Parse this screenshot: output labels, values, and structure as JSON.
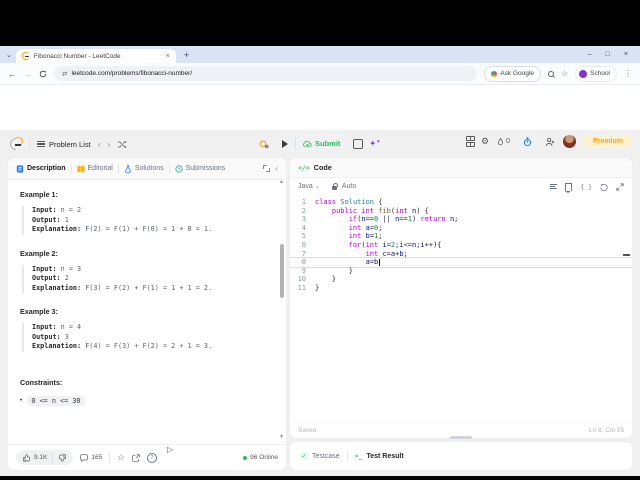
{
  "chrome": {
    "tab_title": "Fibonacci Number - LeetCode",
    "new_tab": "+",
    "url": "leetcode.com/problems/fibonacci-number/",
    "ask_google": "Ask Google",
    "profile_label": "School",
    "window": {
      "minimize": "–",
      "maximize": "□",
      "close": "×"
    }
  },
  "nav": {
    "problem_list_label": "Problem List",
    "submit_label": "Submit",
    "streak_count": "0",
    "premium_label": "Premium"
  },
  "left": {
    "tabs": [
      "Description",
      "Editorial",
      "Solutions",
      "Submissions"
    ],
    "labels": {
      "input": "Input:",
      "output": "Output:",
      "explanation": "Explanation:"
    },
    "examples": [
      {
        "title": "Example 1:",
        "input": "n = 2",
        "output": "1",
        "explanation": "F(2) = F(1) + F(0) = 1 + 0 = 1."
      },
      {
        "title": "Example 2:",
        "input": "n = 3",
        "output": "2",
        "explanation": "F(3) = F(2) + F(1) = 1 + 1 = 2."
      },
      {
        "title": "Example 3:",
        "input": "n = 4",
        "output": "3",
        "explanation": "F(4) = F(3) + F(2) = 2 + 1 = 3."
      }
    ],
    "constraints_title": "Constraints:",
    "constraint_1": "0 <= n <= 30",
    "footer": {
      "likes": "9.1K",
      "comments": "165",
      "online": "96 Online"
    }
  },
  "editor": {
    "panel_title": "Code",
    "language": "Java",
    "autocomplete": "Auto",
    "saved": "Saved",
    "cursor_pos": "Ln 8, Col 16",
    "current_line": 8,
    "lines": [
      {
        "n": "1",
        "tk": [
          [
            "kw",
            "class"
          ],
          [
            "pl",
            " "
          ],
          [
            "ty",
            "Solution"
          ],
          [
            "pl",
            " {"
          ]
        ]
      },
      {
        "n": "2",
        "tk": [
          [
            "pl",
            "    "
          ],
          [
            "kw",
            "public"
          ],
          [
            "pl",
            " "
          ],
          [
            "kw",
            "int"
          ],
          [
            "pl",
            " "
          ],
          [
            "fn",
            "fib"
          ],
          [
            "pl",
            "("
          ],
          [
            "kw",
            "int"
          ],
          [
            "pl",
            " "
          ],
          [
            "va",
            "n"
          ],
          [
            "pl",
            ") {"
          ]
        ]
      },
      {
        "n": "3",
        "tk": [
          [
            "pl",
            "        "
          ],
          [
            "kw",
            "if"
          ],
          [
            "pl",
            "("
          ],
          [
            "va",
            "n"
          ],
          [
            "pl",
            "=="
          ],
          [
            "num",
            "0"
          ],
          [
            "pl",
            " || "
          ],
          [
            "va",
            "n"
          ],
          [
            "pl",
            "=="
          ],
          [
            "num",
            "1"
          ],
          [
            "pl",
            ") "
          ],
          [
            "kw",
            "return"
          ],
          [
            "pl",
            " "
          ],
          [
            "va",
            "n"
          ],
          [
            "pl",
            ";"
          ]
        ]
      },
      {
        "n": "4",
        "tk": [
          [
            "pl",
            "        "
          ],
          [
            "kw",
            "int"
          ],
          [
            "pl",
            " "
          ],
          [
            "va",
            "a"
          ],
          [
            "pl",
            "="
          ],
          [
            "num",
            "0"
          ],
          [
            "pl",
            ";"
          ]
        ]
      },
      {
        "n": "5",
        "tk": [
          [
            "pl",
            "        "
          ],
          [
            "kw",
            "int"
          ],
          [
            "pl",
            " "
          ],
          [
            "va",
            "b"
          ],
          [
            "pl",
            "="
          ],
          [
            "num",
            "1"
          ],
          [
            "pl",
            ";"
          ]
        ]
      },
      {
        "n": "6",
        "tk": [
          [
            "pl",
            "        "
          ],
          [
            "kw",
            "for"
          ],
          [
            "pl",
            "("
          ],
          [
            "kw",
            "int"
          ],
          [
            "pl",
            " "
          ],
          [
            "va",
            "i"
          ],
          [
            "pl",
            "="
          ],
          [
            "num",
            "2"
          ],
          [
            "pl",
            ";"
          ],
          [
            "va",
            "i"
          ],
          [
            "pl",
            "<="
          ],
          [
            "va",
            "n"
          ],
          [
            "pl",
            ";"
          ],
          [
            "va",
            "i"
          ],
          [
            "pl",
            "++){"
          ]
        ]
      },
      {
        "n": "7",
        "tk": [
          [
            "pl",
            "            "
          ],
          [
            "kw",
            "int"
          ],
          [
            "pl",
            " "
          ],
          [
            "va",
            "c"
          ],
          [
            "pl",
            "="
          ],
          [
            "va",
            "a"
          ],
          [
            "pl",
            "+"
          ],
          [
            "va",
            "b"
          ],
          [
            "pl",
            ";"
          ]
        ]
      },
      {
        "n": "8",
        "tk": [
          [
            "pl",
            "            "
          ],
          [
            "va",
            "a"
          ],
          [
            "pl",
            "="
          ],
          [
            "va",
            "b"
          ]
        ]
      },
      {
        "n": "9",
        "tk": [
          [
            "pl",
            "        "
          ],
          [
            "pl",
            "}"
          ]
        ]
      },
      {
        "n": "10",
        "tk": [
          [
            "pl",
            "    "
          ],
          [
            "pl",
            "}"
          ]
        ]
      },
      {
        "n": "11",
        "tk": [
          [
            "pl",
            "}"
          ]
        ]
      }
    ]
  },
  "bottom": {
    "testcase": "Testcase",
    "test_result": "Test Result"
  },
  "colors": {
    "accent_green": "#2cbb5d",
    "premium_orange": "#ffa116",
    "keyword_purple": "#af00db"
  }
}
